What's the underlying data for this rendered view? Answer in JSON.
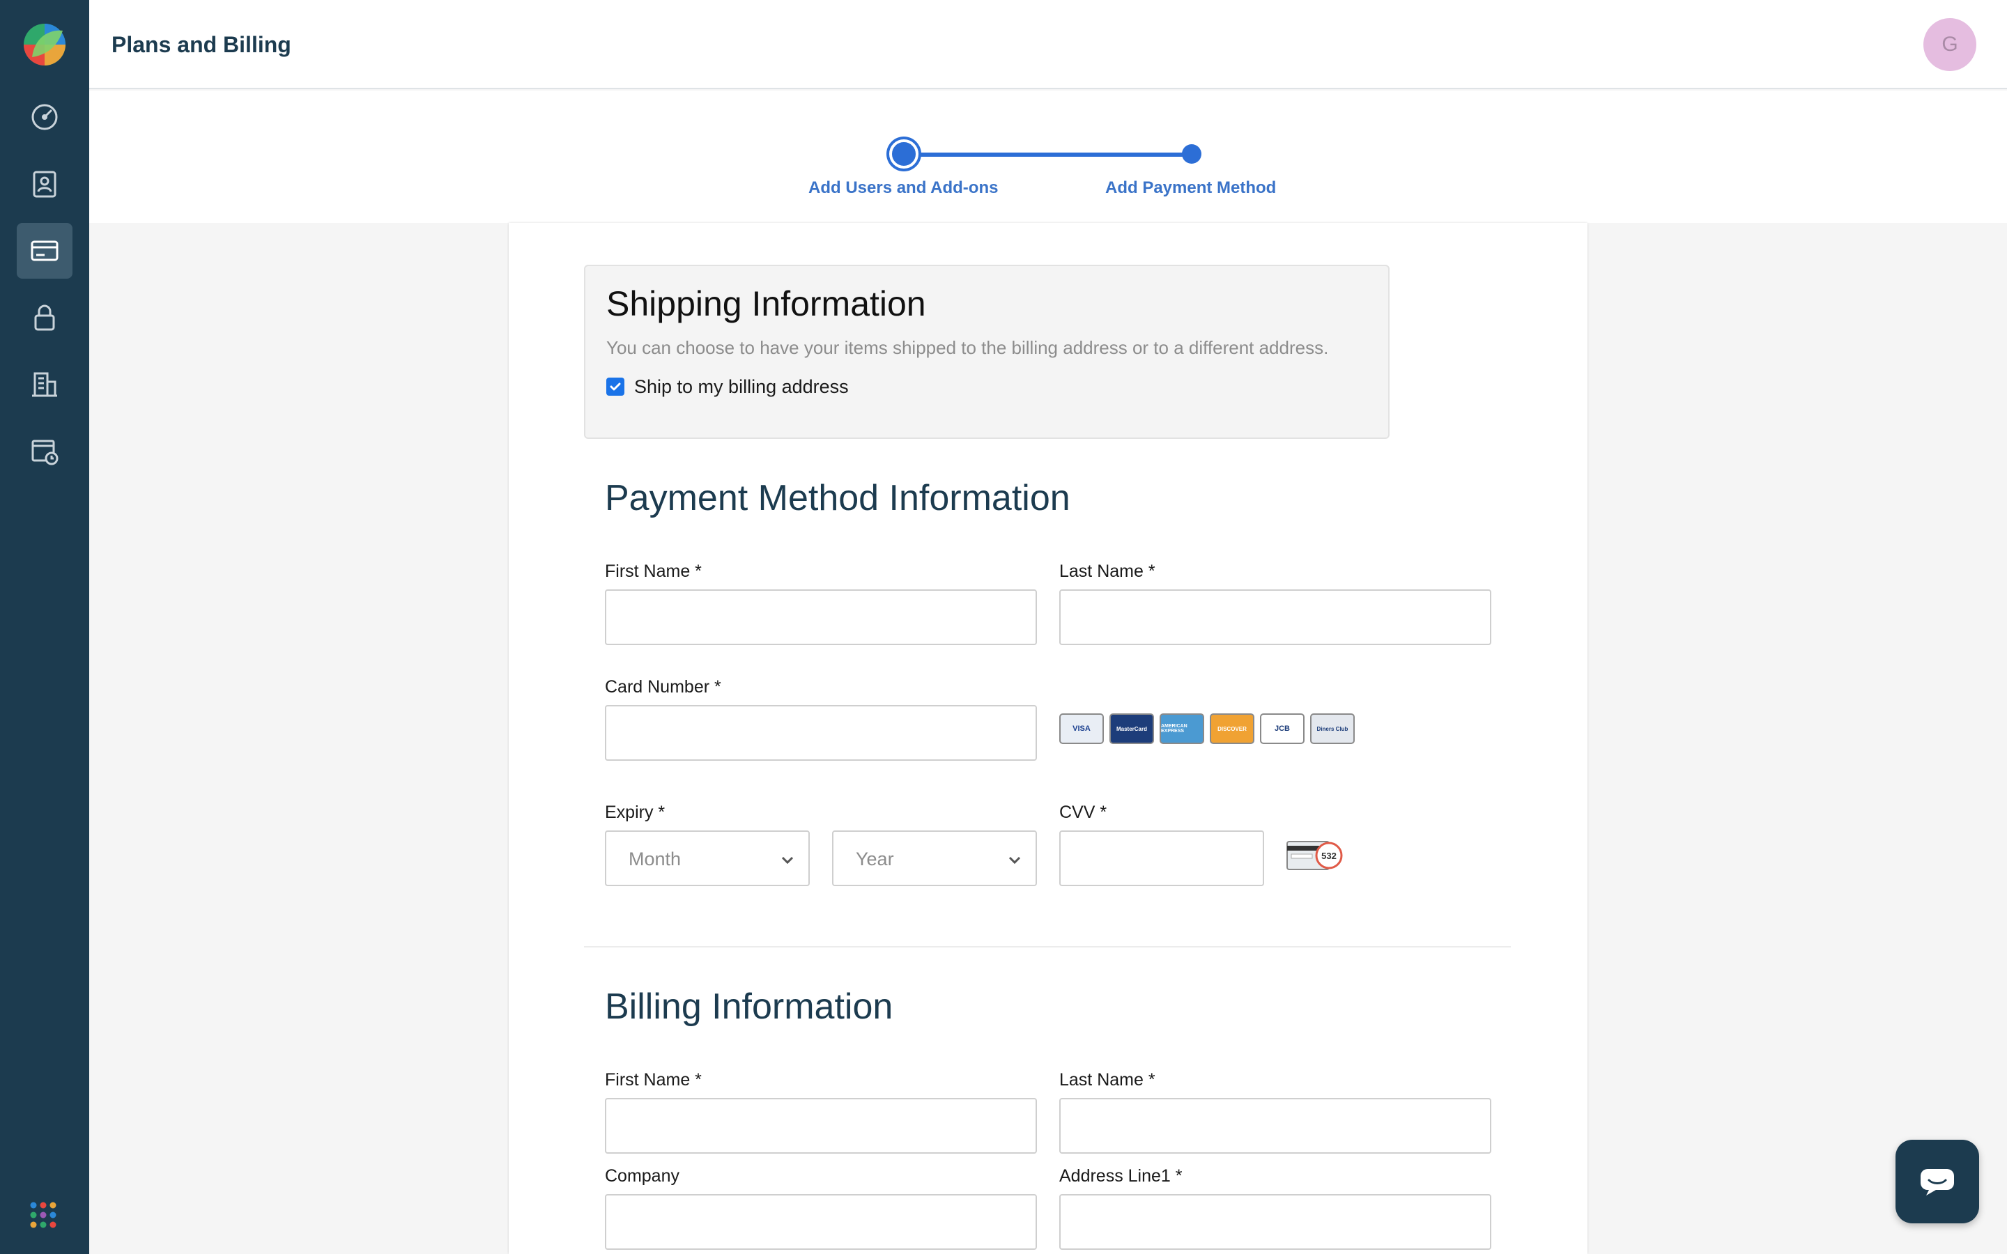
{
  "header": {
    "title": "Plans and Billing",
    "avatar_initial": "G"
  },
  "sidebar": {
    "items": [
      {
        "name": "dashboard",
        "icon": "speedometer-icon",
        "active": false
      },
      {
        "name": "contacts",
        "icon": "user-badge-icon",
        "active": false
      },
      {
        "name": "billing",
        "icon": "credit-card-icon",
        "active": true
      },
      {
        "name": "security",
        "icon": "lock-icon",
        "active": false
      },
      {
        "name": "organization",
        "icon": "building-icon",
        "active": false
      },
      {
        "name": "schedule",
        "icon": "calendar-clock-icon",
        "active": false
      }
    ]
  },
  "stepper": {
    "steps": [
      {
        "label": "Add Users and Add-ons"
      },
      {
        "label": "Add Payment Method"
      }
    ],
    "accent": "#2c6ed6"
  },
  "shipping": {
    "title": "Shipping Information",
    "description": "You can choose to have your items shipped to the billing address or to a different address.",
    "checkbox_label": "Ship to my billing address",
    "checked": true
  },
  "payment": {
    "title": "Payment Method Information",
    "first_name_label": "First Name *",
    "last_name_label": "Last Name *",
    "card_number_label": "Card Number *",
    "expiry_label": "Expiry *",
    "month_placeholder": "Month",
    "year_placeholder": "Year",
    "cvv_label": "CVV *",
    "card_brands": [
      "VISA",
      "MasterCard",
      "AMERICAN EXPRESS",
      "DISCOVER",
      "JCB",
      "Diners Club"
    ],
    "cvv_hint": "532"
  },
  "billing": {
    "title": "Billing Information",
    "first_name_label": "First Name *",
    "last_name_label": "Last Name *",
    "company_label": "Company",
    "address_line1_label": "Address Line1 *"
  }
}
